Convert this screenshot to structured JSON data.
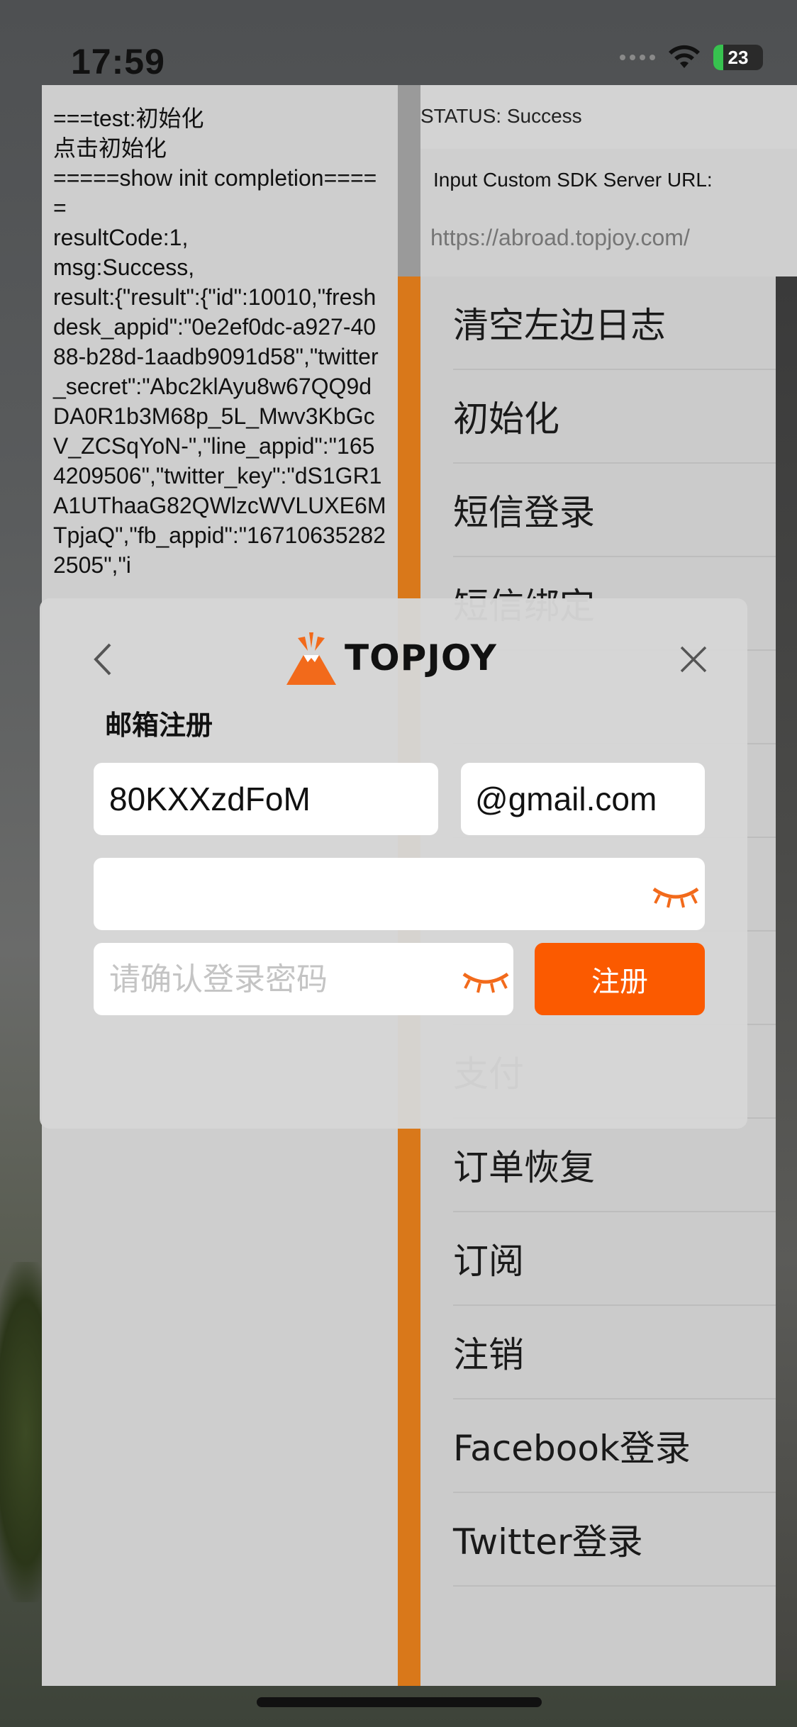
{
  "status_bar": {
    "time": "17:59",
    "battery_level": "23",
    "icons": [
      "signal-icon",
      "wifi-icon",
      "battery-icon"
    ]
  },
  "log": {
    "text": "===test:初始化\n点击初始化\n=====show init completion=====\nresultCode:1,\nmsg:Success,\nresult:{\"result\":{\"id\":10010,\"freshdesk_appid\":\"0e2ef0dc-a927-4088-b28d-1aadb9091d58\",\"twitter_secret\":\"Abc2klAyu8w67QQ9dDA0R1b3M68p_5L_Mwv3KbGcV_ZCSqYoN-\",\"line_appid\":\"1654209506\",\"twitter_key\":\"dS1GR1A1UThaaG82QWlzcWVLUXE6MTpjaQ\",\"fb_appid\":\"167106352822505\",\"i"
  },
  "right_panel": {
    "status": "STATUS: Success",
    "url_label": "Input Custom SDK Server URL:",
    "url_placeholder": "https://abroad.topjoy.com/",
    "menu": [
      "清空左边日志",
      "初始化",
      "短信登录",
      "短信绑定",
      "",
      "",
      "",
      "",
      "支付",
      "订单恢复",
      "订阅",
      "注销",
      "Facebook登录",
      "Twitter登录"
    ]
  },
  "modal": {
    "brand": "TOPJOY",
    "title": "邮箱注册",
    "username_value": "80KXXzdFoM",
    "domain": "@gmail.com",
    "password_value": "",
    "confirm_placeholder": "请确认登录密码",
    "register_label": "注册"
  },
  "colors": {
    "accent": "#fb5a00",
    "divider": "#d9781a"
  }
}
